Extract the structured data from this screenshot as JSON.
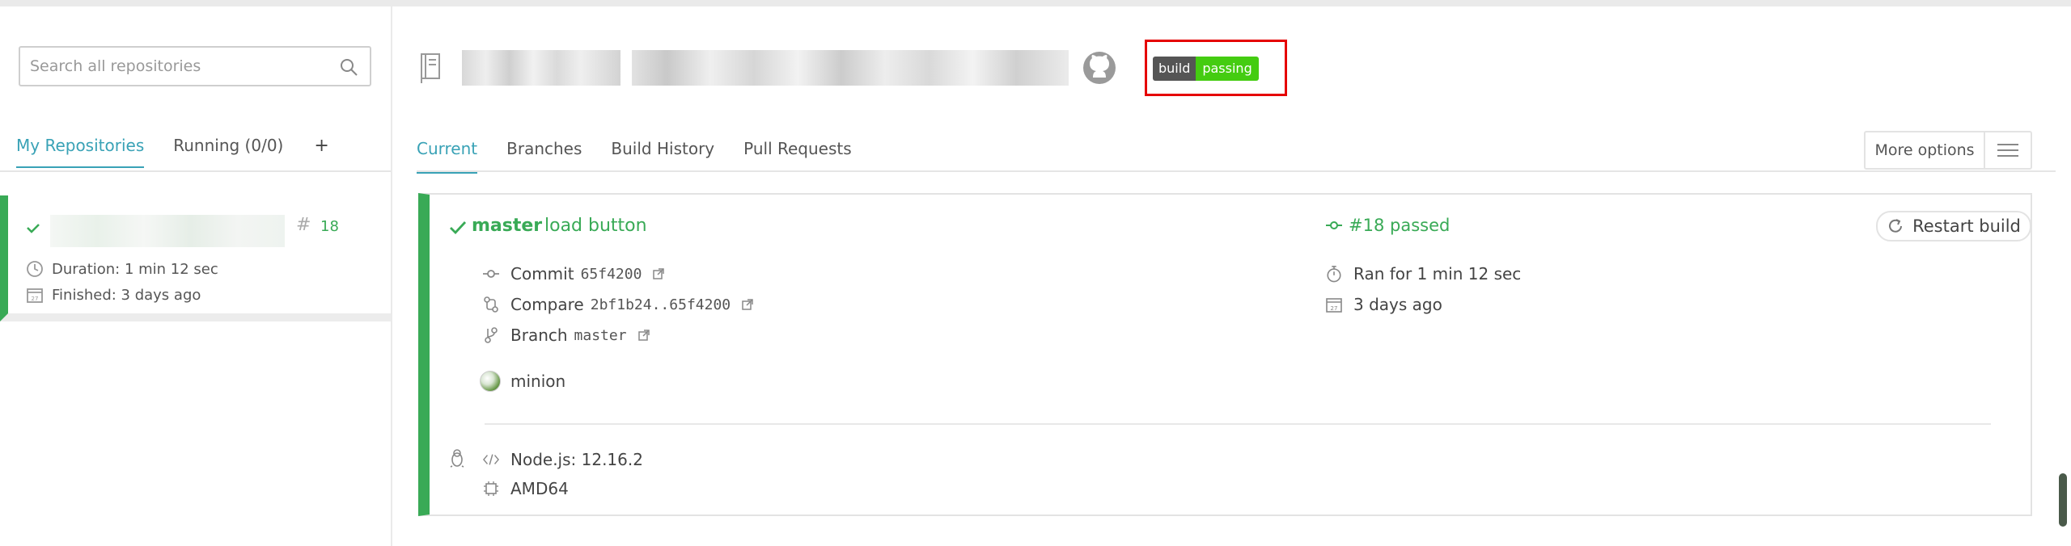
{
  "search": {
    "placeholder": "Search all repositories"
  },
  "sidebar": {
    "tabs": [
      {
        "label": "My Repositories"
      },
      {
        "label": "Running (0/0)"
      },
      {
        "label": "+"
      }
    ],
    "repo": {
      "number": "18",
      "duration": "Duration: 1 min 12 sec",
      "finished": "Finished: 3 days ago"
    }
  },
  "badge": {
    "left": "build",
    "right": "passing"
  },
  "main": {
    "tabs": [
      {
        "label": "Current"
      },
      {
        "label": "Branches"
      },
      {
        "label": "Build History"
      },
      {
        "label": "Pull Requests"
      }
    ],
    "more_options": "More options"
  },
  "build": {
    "branch": "master",
    "message": "load button",
    "status": "#18 passed",
    "restart": "Restart build",
    "commit_label": "Commit",
    "commit_sha": "65f4200",
    "compare_label": "Compare",
    "compare_range": "2bf1b24..65f4200",
    "branch_label": "Branch",
    "branch_value": "master",
    "ran_for": "Ran for 1 min 12 sec",
    "date": "3 days ago",
    "author": "minion",
    "language": "Node.js: 12.16.2",
    "arch": "AMD64"
  },
  "colors": {
    "accent": "#39a2b6",
    "passed": "#39aa56",
    "highlight_box": "#e50000"
  }
}
